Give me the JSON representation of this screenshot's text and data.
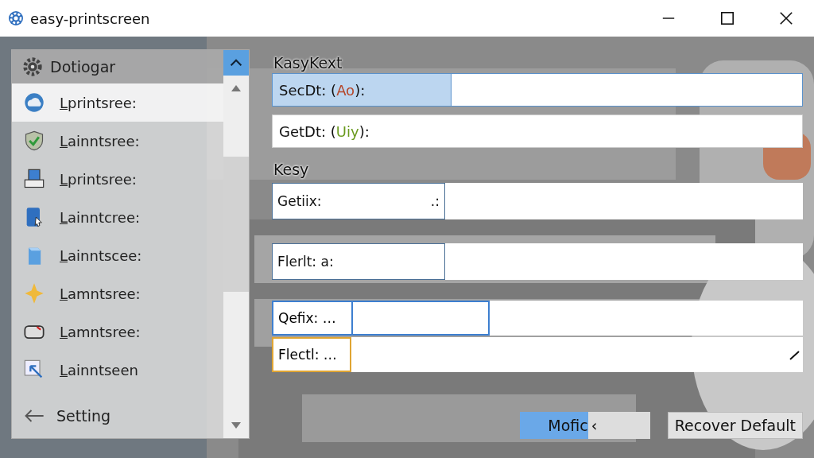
{
  "window": {
    "title": "easy-printscreen"
  },
  "sidebar": {
    "header": "Dotiogar",
    "items": [
      {
        "label": "Lprintsree:",
        "kind": "cloud",
        "selected": true
      },
      {
        "label": "Lainntsree:",
        "kind": "shield",
        "selected": false
      },
      {
        "label": "Lprintsree:",
        "kind": "printer",
        "selected": false
      },
      {
        "label": "Lainntcree:",
        "kind": "tablet",
        "selected": false
      },
      {
        "label": "Lainntscee:",
        "kind": "box",
        "selected": false
      },
      {
        "label": "Lamntsree:",
        "kind": "star",
        "selected": false
      },
      {
        "label": "Lamntsree:",
        "kind": "drive",
        "selected": false
      },
      {
        "label": "Lainntseen",
        "kind": "pointer",
        "selected": false
      }
    ],
    "footer": "Setting"
  },
  "main": {
    "items": [
      {
        "kind": "heading",
        "text": "KasyKext"
      },
      {
        "kind": "wide",
        "label": "SecDt: (",
        "accent": "Ao",
        "color": "#b5472a",
        "tail": "):",
        "focused": true
      },
      {
        "kind": "wide",
        "label": "GetDt: (",
        "accent": "Uiy",
        "color": "#6a9a1e",
        "tail": "):",
        "focused": false
      },
      {
        "kind": "heading",
        "text": "Kesy"
      },
      {
        "kind": "boxed",
        "label": "Getiix:",
        "extra": ".:"
      },
      {
        "kind": "boxed",
        "label": "Flerlt: a:"
      },
      {
        "kind": "split",
        "label": "Qefix: …",
        "color": "#3d7fd0"
      },
      {
        "kind": "split-last",
        "label": "Flectl: …",
        "color": "#e0a533"
      }
    ],
    "buttons": [
      {
        "label": "Mofic",
        "glyph": "‹",
        "primary": true
      },
      {
        "label": "Recover Default",
        "primary": false
      }
    ]
  }
}
